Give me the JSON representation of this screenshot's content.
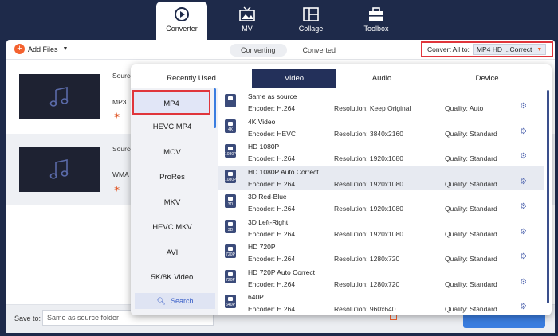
{
  "nav": [
    {
      "label": "Converter",
      "icon": "converter-icon",
      "active": true
    },
    {
      "label": "MV",
      "icon": "mv-icon"
    },
    {
      "label": "Collage",
      "icon": "collage-icon"
    },
    {
      "label": "Toolbox",
      "icon": "toolbox-icon"
    }
  ],
  "toolbar": {
    "add_files": "Add Files",
    "tabs": [
      "Converting",
      "Converted"
    ],
    "convert_all_label": "Convert All to:",
    "convert_all_value": "MP4 HD ...Correct"
  },
  "files": [
    {
      "source": "Source",
      "format": "MP3"
    },
    {
      "source": "Source",
      "format": "WMA"
    }
  ],
  "panel": {
    "tabs": [
      "Recently Used",
      "Video",
      "Audio",
      "Device"
    ],
    "active_tab": "Video",
    "categories": [
      "MP4",
      "HEVC MP4",
      "MOV",
      "ProRes",
      "MKV",
      "HEVC MKV",
      "AVI",
      "5K/8K Video"
    ],
    "active_category": "MP4",
    "search_label": "Search",
    "formats": [
      {
        "name": "Same as source",
        "encoder": "Encoder: H.264",
        "resolution": "Resolution: Keep Original",
        "quality": "Quality: Auto",
        "badge": ""
      },
      {
        "name": "4K Video",
        "encoder": "Encoder: HEVC",
        "resolution": "Resolution: 3840x2160",
        "quality": "Quality: Standard",
        "badge": "4K"
      },
      {
        "name": "HD 1080P",
        "encoder": "Encoder: H.264",
        "resolution": "Resolution: 1920x1080",
        "quality": "Quality: Standard",
        "badge": "1080P"
      },
      {
        "name": "HD 1080P Auto Correct",
        "encoder": "Encoder: H.264",
        "resolution": "Resolution: 1920x1080",
        "quality": "Quality: Standard",
        "badge": "1080P"
      },
      {
        "name": "3D Red-Blue",
        "encoder": "Encoder: H.264",
        "resolution": "Resolution: 1920x1080",
        "quality": "Quality: Standard",
        "badge": "3D"
      },
      {
        "name": "3D Left-Right",
        "encoder": "Encoder: H.264",
        "resolution": "Resolution: 1920x1080",
        "quality": "Quality: Standard",
        "badge": "3D"
      },
      {
        "name": "HD 720P",
        "encoder": "Encoder: H.264",
        "resolution": "Resolution: 1280x720",
        "quality": "Quality: Standard",
        "badge": "720P"
      },
      {
        "name": "HD 720P Auto Correct",
        "encoder": "Encoder: H.264",
        "resolution": "Resolution: 1280x720",
        "quality": "Quality: Standard",
        "badge": "720P"
      },
      {
        "name": "640P",
        "encoder": "Encoder: H.264",
        "resolution": "Resolution: 960x640",
        "quality": "Quality: Standard",
        "badge": "640P"
      }
    ],
    "selected_index": 3
  },
  "bottom": {
    "save_to_label": "Save to:",
    "save_to_value": "Same as source folder"
  },
  "colors": {
    "accent": "#3a7de0",
    "highlight": "#e0353b",
    "nav_bg": "#1e2a4a",
    "active_tab": "#23305a"
  }
}
